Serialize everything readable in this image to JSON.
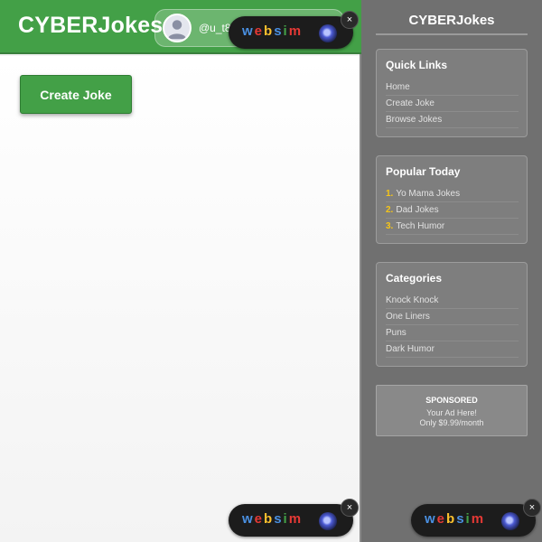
{
  "header": {
    "brand": "CYBERJokes",
    "username": "@u_t8"
  },
  "main": {
    "create_button_label": "Create Joke"
  },
  "sidebar": {
    "title": "CYBERJokes",
    "quick_links": {
      "title": "Quick Links",
      "items": [
        "Home",
        "Create Joke",
        "Browse Jokes"
      ]
    },
    "popular": {
      "title": "Popular Today",
      "items": [
        {
          "rank": "1.",
          "label": "Yo Mama Jokes"
        },
        {
          "rank": "2.",
          "label": "Dad Jokes"
        },
        {
          "rank": "3.",
          "label": "Tech Humor"
        }
      ]
    },
    "categories": {
      "title": "Categories",
      "items": [
        "Knock Knock",
        "One Liners",
        "Puns",
        "Dark Humor"
      ]
    },
    "ad": {
      "heading": "SPONSORED",
      "line1": "Your Ad Here!",
      "line2": "Only $9.99/month"
    }
  },
  "websim_badge": {
    "letters": [
      "w",
      "e",
      "b",
      "s",
      "i",
      "m"
    ],
    "close_label": "×"
  },
  "colors": {
    "brand_green": "#43a047",
    "sidebar_bg": "#707070",
    "rank_gold": "#f5c518"
  }
}
